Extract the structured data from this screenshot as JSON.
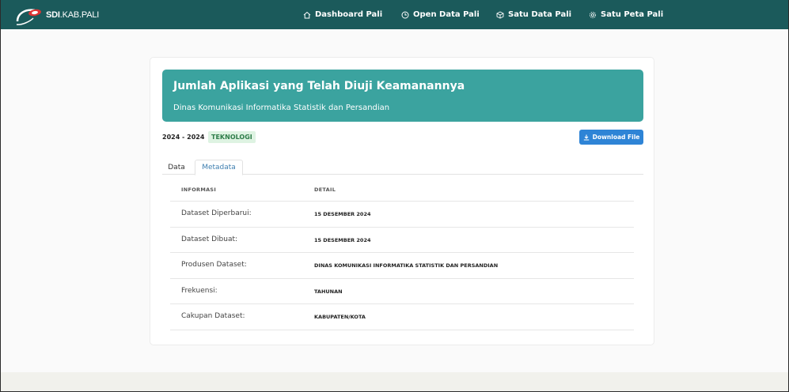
{
  "brand": {
    "bold": "SDI",
    "rest": ".KAB.PALI"
  },
  "nav": [
    {
      "label": "Dashboard Pali",
      "icon": "home-icon"
    },
    {
      "label": "Open Data Pali",
      "icon": "clock-icon"
    },
    {
      "label": "Satu Data Pali",
      "icon": "cube-icon"
    },
    {
      "label": "Satu Peta Pali",
      "icon": "gear-icon"
    }
  ],
  "banner": {
    "title": "Jumlah Aplikasi yang Telah Diuji Keamanannya",
    "subtitle": "Dinas Komunikasi Informatika Statistik dan Persandian"
  },
  "meta": {
    "period": "2024 - 2024",
    "tag": "TEKNOLOGI",
    "download_label": "Download File"
  },
  "tabs": [
    {
      "label": "Data",
      "active": false
    },
    {
      "label": "Metadata",
      "active": true
    }
  ],
  "table": {
    "headers": [
      "INFORMASI",
      "DETAIL"
    ],
    "rows": [
      {
        "label": "Dataset Diperbarui:",
        "value": "15 DESEMBER 2024"
      },
      {
        "label": "Dataset Dibuat:",
        "value": "15 DESEMBER 2024"
      },
      {
        "label": "Produsen Dataset:",
        "value": "DINAS KOMUNIKASI INFORMATIKA STATISTIK DAN PERSANDIAN"
      },
      {
        "label": "Frekuensi:",
        "value": "TAHUNAN"
      },
      {
        "label": "Cakupan Dataset:",
        "value": "KABUPATEN/KOTA"
      }
    ]
  },
  "colors": {
    "navbar": "#1b5a5b",
    "banner": "#3ba39f",
    "tag_bg": "#def3e2",
    "button": "#2e84d6"
  }
}
